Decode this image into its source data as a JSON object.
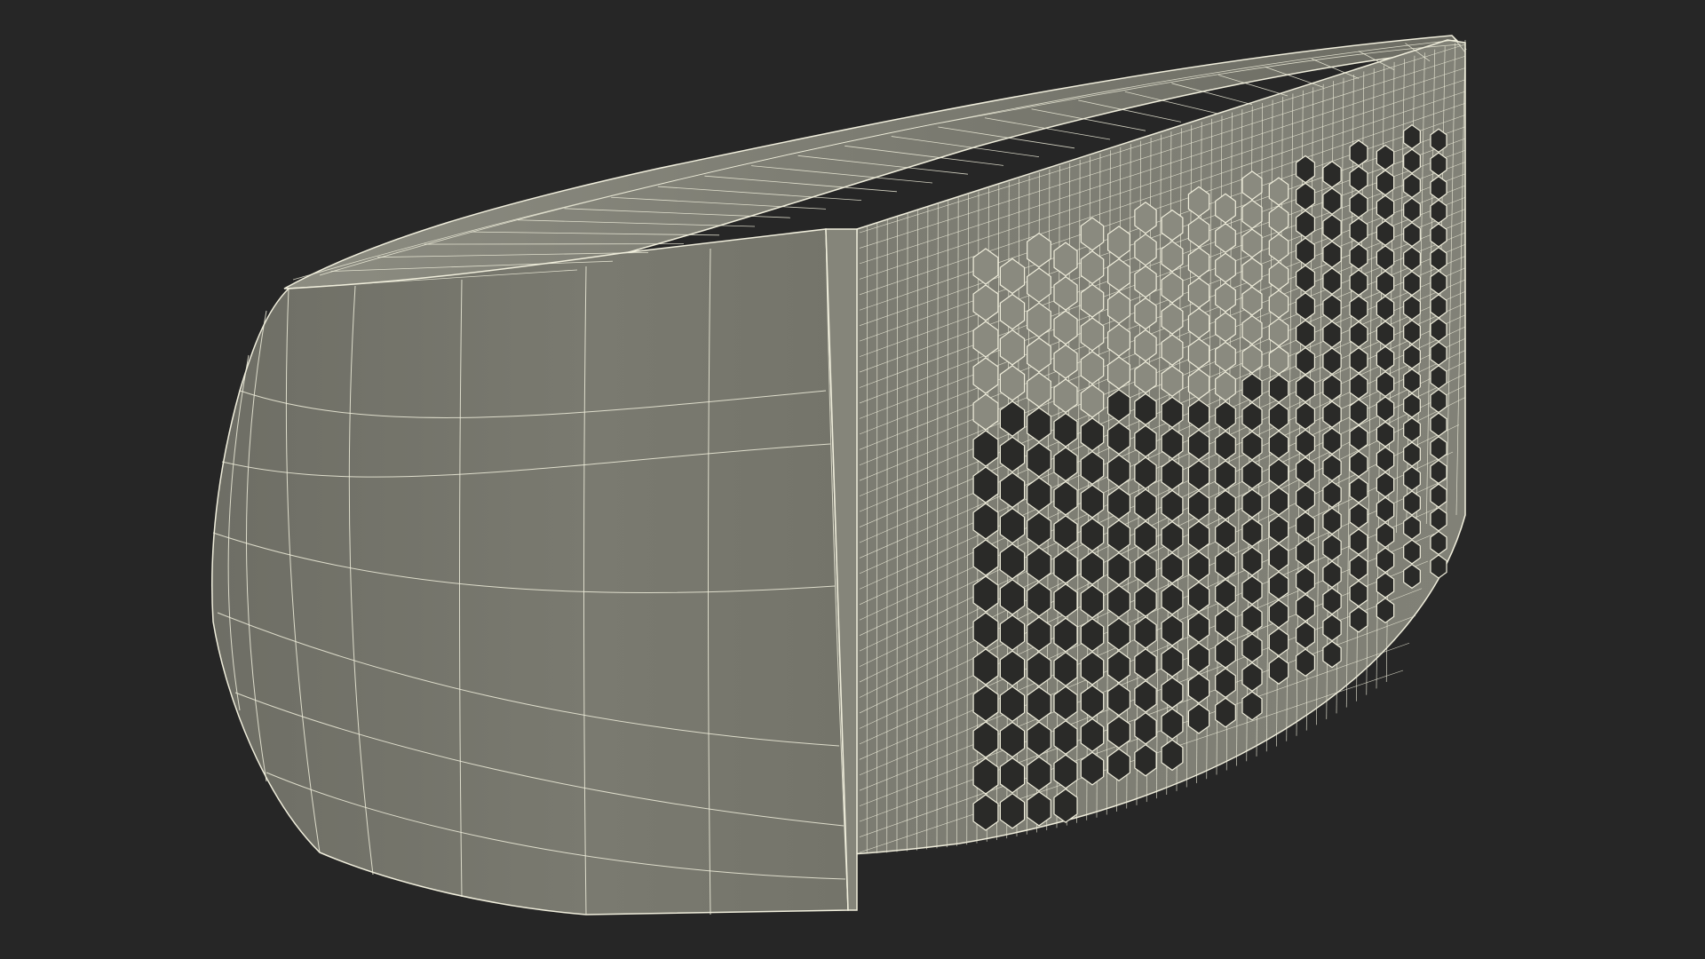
{
  "scene": {
    "subject": "wireframe-3d-model-perforated-band",
    "colors": {
      "background": "#262626",
      "surface": "#7a7a70",
      "surface_dark": "#64645b",
      "surface_light": "#8a8a7f",
      "wire": "#f0eedc",
      "hole": "#2a2a28"
    }
  }
}
